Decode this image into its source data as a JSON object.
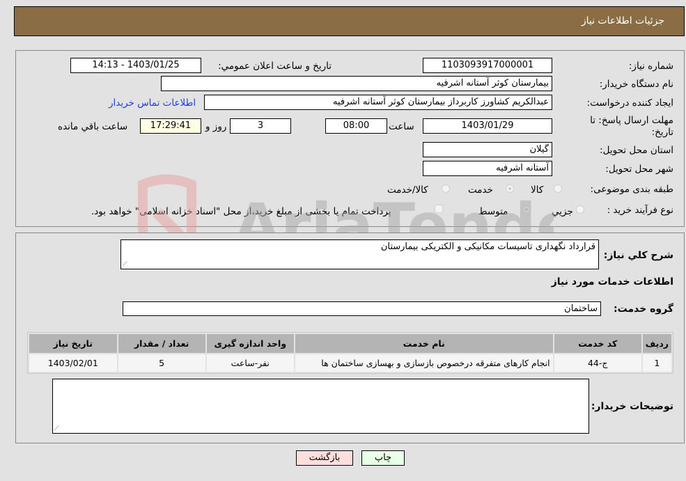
{
  "header": {
    "title": "جزئیات اطلاعات نیاز"
  },
  "details": {
    "need_number": {
      "label": "شماره نیاز:",
      "value": "1103093917000001"
    },
    "announce_datetime": {
      "label": "تاریخ و ساعت اعلان عمومي:",
      "value": "1403/01/25 - 14:13"
    },
    "buyer_org": {
      "label": "نام دستگاه خریدار:",
      "value": "بیمارستان کوثر آستانه اشرفیه"
    },
    "requester": {
      "label": "ایجاد کننده درخواست:",
      "value": "عبدالکریم کشاورز کاربرداز بیمارستان کوثر آستانه اشرفیه"
    },
    "buyer_contact_link": "اطلاعات تماس خریدار",
    "deadline": {
      "label": "مهلت ارسال پاسخ: تا تاریخ:",
      "date": "1403/01/29",
      "time_label": "ساعت",
      "time": "08:00",
      "days": "3",
      "days_label": "روز و",
      "remaining": "17:29:41",
      "remaining_label": "ساعت باقي مانده"
    },
    "province": {
      "label": "استان محل تحویل:",
      "value": "گیلان"
    },
    "city": {
      "label": "شهر محل تحویل:",
      "value": "آستانه اشرفیه"
    },
    "category": {
      "label": "طبقه بندی موضوعی:",
      "options": [
        "کالا",
        "خدمت",
        "کالا/خدمت"
      ],
      "selected": "خدمت"
    },
    "purchase_type": {
      "label": "نوع فرآیند خرید :",
      "options": [
        "جزيي",
        "متوسط"
      ],
      "selected": "متوسط",
      "treasury_note": "پرداخت تمام یا بخشی از مبلغ خرید،از محل \"اسناد خزانه اسلامی\" خواهد بود."
    }
  },
  "services": {
    "description_label": "شرح کلي نیاز:",
    "description": "قرارداد نگهداری تاسیسات مکانیکی و الکتریکی بیمارستان",
    "section_title": "اطلاعات خدمات مورد نیاز",
    "group_label": "گروه خدمت:",
    "group_value": "ساختمان",
    "table": {
      "headers": [
        "ردیف",
        "کد خدمت",
        "نام خدمت",
        "واحد اندازه گیری",
        "تعداد / مقدار",
        "تاریخ نیاز"
      ],
      "rows": [
        [
          "1",
          "ج-44",
          "انجام کارهای متفرقه درخصوص بازسازی و بهسازی ساختمان ها",
          "نفر-ساعت",
          "5",
          "1403/02/01"
        ]
      ]
    },
    "buyer_notes_label": "توضیحات خریدار:",
    "buyer_notes": ""
  },
  "buttons": {
    "print": "چاپ",
    "back": "بازگشت"
  },
  "watermark": {
    "text": "AriaTender.neT"
  },
  "colors": {
    "header_bg": "#8b6d45",
    "print_bg": "#e8ffe8",
    "back_bg": "#ffdede",
    "link": "#1f3ed6"
  }
}
